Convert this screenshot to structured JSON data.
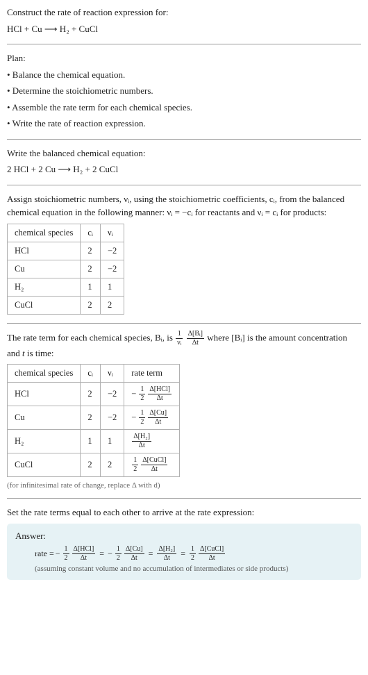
{
  "header": {
    "prompt": "Construct the rate of reaction expression for:",
    "equation": "HCl + Cu  ⟶  H₂ + CuCl"
  },
  "plan": {
    "title": "Plan:",
    "items": [
      "• Balance the chemical equation.",
      "• Determine the stoichiometric numbers.",
      "• Assemble the rate term for each chemical species.",
      "• Write the rate of reaction expression."
    ]
  },
  "balanced": {
    "title": "Write the balanced chemical equation:",
    "equation": "2 HCl + 2 Cu  ⟶  H₂ + 2 CuCl"
  },
  "stoich": {
    "intro_a": "Assign stoichiometric numbers, νᵢ, using the stoichiometric coefficients, cᵢ, from the balanced chemical equation in the following manner: νᵢ = −cᵢ for reactants and νᵢ = cᵢ for products:",
    "headers": {
      "species": "chemical species",
      "ci": "cᵢ",
      "vi": "νᵢ"
    },
    "rows": [
      {
        "species": "HCl",
        "ci": "2",
        "vi": "−2"
      },
      {
        "species": "Cu",
        "ci": "2",
        "vi": "−2"
      },
      {
        "species": "H₂",
        "ci": "1",
        "vi": "1"
      },
      {
        "species": "CuCl",
        "ci": "2",
        "vi": "2"
      }
    ]
  },
  "rateterm": {
    "intro_pre": "The rate term for each chemical species, Bᵢ, is ",
    "intro_mid": " where [Bᵢ] is the amount concentration and ",
    "intro_t": "t",
    "intro_post": " is time:",
    "frac1": {
      "num": "1",
      "den": "νᵢ"
    },
    "frac2": {
      "num": "Δ[Bᵢ]",
      "den": "Δt"
    },
    "headers": {
      "species": "chemical species",
      "ci": "cᵢ",
      "vi": "νᵢ",
      "term": "rate term"
    },
    "rows": [
      {
        "species": "HCl",
        "ci": "2",
        "vi": "−2",
        "neg": "−",
        "coef_num": "1",
        "coef_den": "2",
        "dnum": "Δ[HCl]",
        "dden": "Δt"
      },
      {
        "species": "Cu",
        "ci": "2",
        "vi": "−2",
        "neg": "−",
        "coef_num": "1",
        "coef_den": "2",
        "dnum": "Δ[Cu]",
        "dden": "Δt"
      },
      {
        "species": "H₂",
        "ci": "1",
        "vi": "1",
        "neg": "",
        "coef_num": "",
        "coef_den": "",
        "dnum": "Δ[H₂]",
        "dden": "Δt"
      },
      {
        "species": "CuCl",
        "ci": "2",
        "vi": "2",
        "neg": "",
        "coef_num": "1",
        "coef_den": "2",
        "dnum": "Δ[CuCl]",
        "dden": "Δt"
      }
    ],
    "footnote": "(for infinitesimal rate of change, replace Δ with d)"
  },
  "final": {
    "title": "Set the rate terms equal to each other to arrive at the rate expression:"
  },
  "answer": {
    "label": "Answer:",
    "lead": "rate = ",
    "eq": "=",
    "terms": [
      {
        "neg": "−",
        "cnum": "1",
        "cden": "2",
        "dnum": "Δ[HCl]",
        "dden": "Δt"
      },
      {
        "neg": "−",
        "cnum": "1",
        "cden": "2",
        "dnum": "Δ[Cu]",
        "dden": "Δt"
      },
      {
        "neg": "",
        "cnum": "",
        "cden": "",
        "dnum": "Δ[H₂]",
        "dden": "Δt"
      },
      {
        "neg": "",
        "cnum": "1",
        "cden": "2",
        "dnum": "Δ[CuCl]",
        "dden": "Δt"
      }
    ],
    "note": "(assuming constant volume and no accumulation of intermediates or side products)"
  }
}
